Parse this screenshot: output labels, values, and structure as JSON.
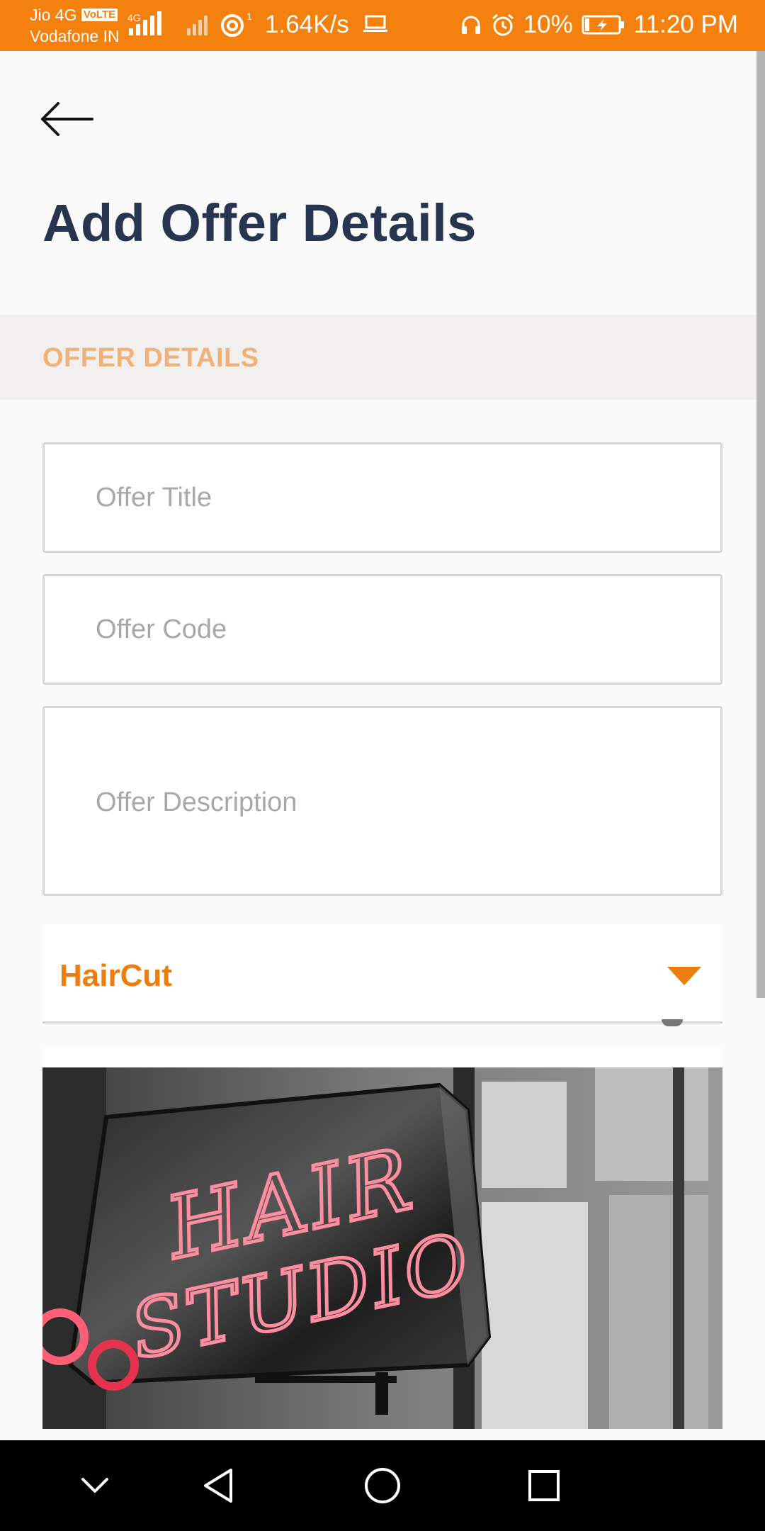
{
  "status_bar": {
    "carrier_1": "Jio 4G",
    "volte": "VoLTE",
    "carrier_2": "Vodafone IN",
    "network_type": "4G",
    "speed": "1.64K/s",
    "battery": "10%",
    "time": "11:20 PM"
  },
  "header": {
    "back_icon": "arrow-left-icon",
    "title": "Add Offer Details"
  },
  "section": {
    "title": "OFFER DETAILS"
  },
  "form": {
    "offer_title": {
      "placeholder": "Offer Title",
      "value": ""
    },
    "offer_code": {
      "placeholder": "Offer Code",
      "value": ""
    },
    "offer_description": {
      "placeholder": "Offer Description",
      "value": ""
    },
    "category": {
      "selected": "HairCut"
    }
  },
  "offer_image": {
    "sign_text": "HAIR STUDIO"
  },
  "colors": {
    "accent": "#f4800e",
    "title": "#283550",
    "section_label": "#f0b27a"
  }
}
